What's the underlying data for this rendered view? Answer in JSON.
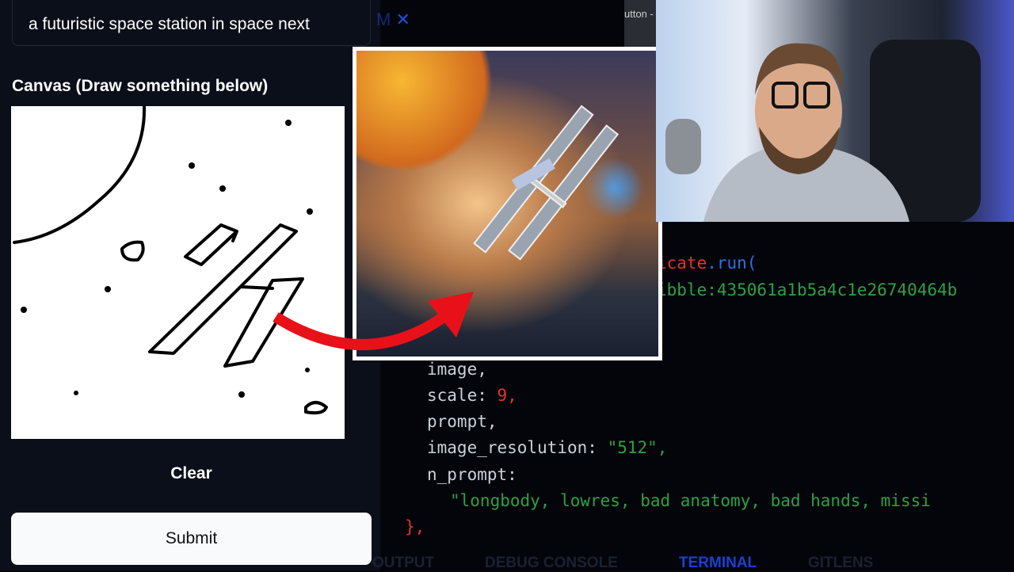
{
  "prompt_input": {
    "value": "a futuristic space station in space next"
  },
  "canvas": {
    "label": "Canvas (Draw something below)"
  },
  "buttons": {
    "clear": "Clear",
    "submit": "Submit"
  },
  "editor": {
    "tab_fragment": "M",
    "top_right_fragment": "utton -",
    "lines": {
      "l1a": "icate",
      "l1b": ".run(",
      "l2": "ibble:435061a1b5a4c1e26740464b",
      "l3": "image,",
      "l4a": "scale: ",
      "l4b": "9,",
      "l5": "prompt,",
      "l6a": "image_resolution: ",
      "l6b": "\"512\",",
      "l7": "n_prompt:",
      "l8": "\"longbody, lowres, bad anatomy, bad hands, missi",
      "l9": "},"
    },
    "panel_tabs": [
      "OUTPUT",
      "DEBUG CONSOLE",
      "TERMINAL",
      "GITLENS"
    ]
  },
  "colors": {
    "accent": "#1d4ed8",
    "string": "#2ea043",
    "number": "#e5322d",
    "keyword": "#e5322d",
    "arrow": "#e8111a"
  }
}
